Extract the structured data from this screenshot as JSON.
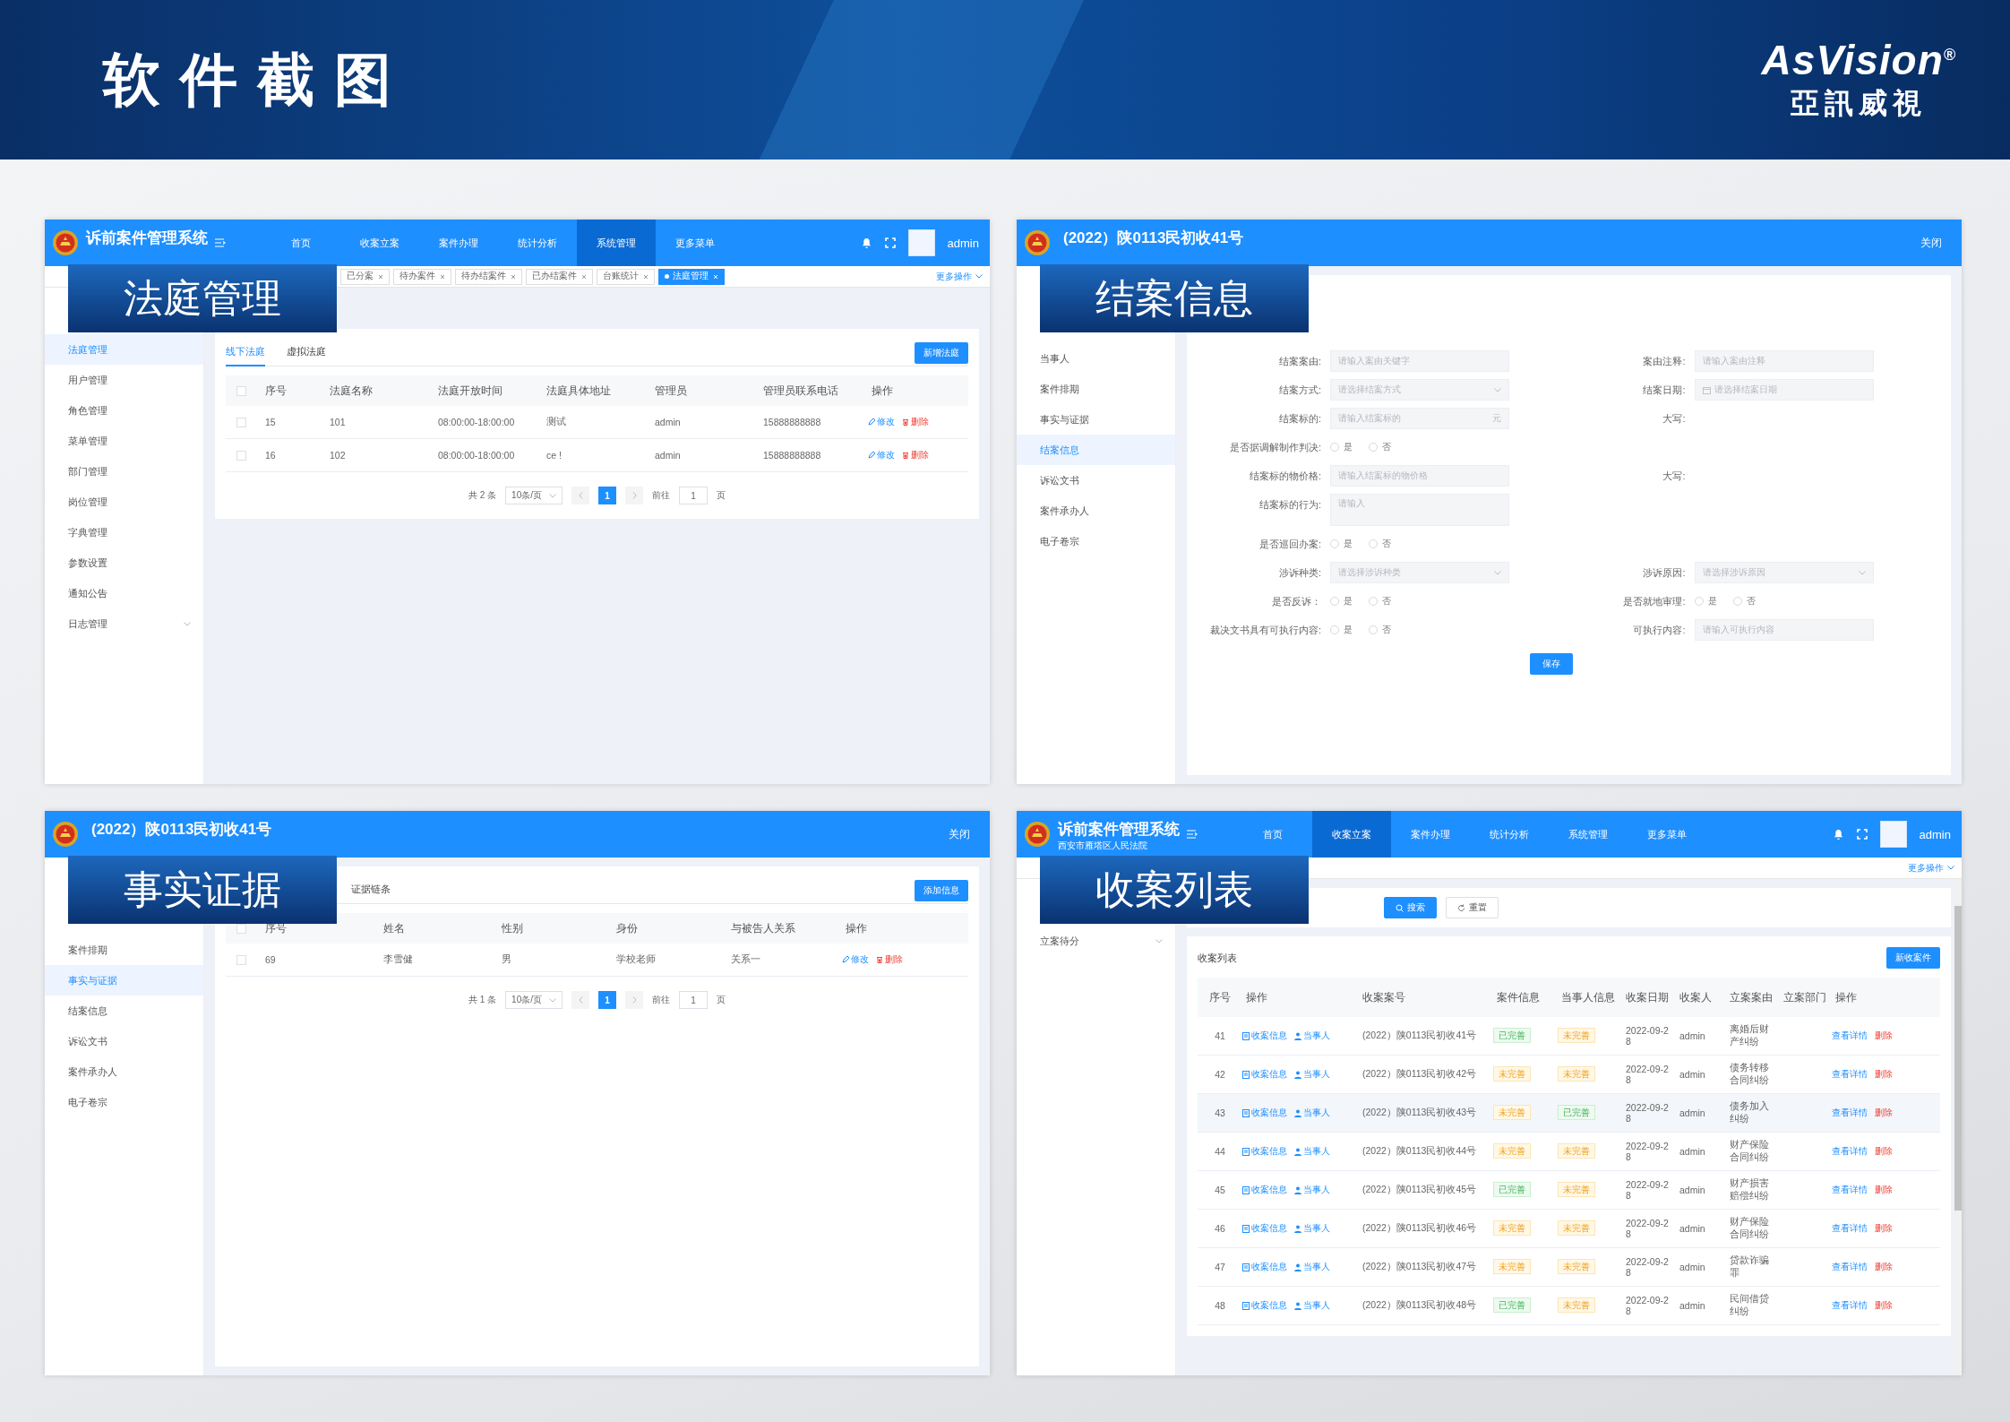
{
  "header": {
    "title": "软件截图",
    "brand": "AsVision",
    "brand_mark": "®",
    "brand_cn": "亞訊威視"
  },
  "panels": [
    {
      "kind": "court",
      "label": "法庭管理",
      "app": {
        "title": "诉前案件管理系统",
        "nav": [
          {
            "label": "首页",
            "selected": false
          },
          {
            "label": "收案立案",
            "selected": false
          },
          {
            "label": "案件办理",
            "selected": false
          },
          {
            "label": "统计分析",
            "selected": false
          },
          {
            "label": "系统管理",
            "selected": true
          },
          {
            "label": "更多菜单",
            "selected": false
          }
        ],
        "user": "admin"
      },
      "tags": [
        {
          "label": "已分案",
          "selected": false
        },
        {
          "label": "待办案件",
          "selected": false
        },
        {
          "label": "待办结案件",
          "selected": false
        },
        {
          "label": "已办结案件",
          "selected": false
        },
        {
          "label": "台账统计",
          "selected": false
        },
        {
          "label": "法庭管理",
          "selected": true
        }
      ],
      "more": "更多操作",
      "sidebar": [
        {
          "label": "法庭管理",
          "selected": true
        },
        {
          "label": "用户管理",
          "selected": false
        },
        {
          "label": "角色管理",
          "selected": false
        },
        {
          "label": "菜单管理",
          "selected": false
        },
        {
          "label": "部门管理",
          "selected": false
        },
        {
          "label": "岗位管理",
          "selected": false
        },
        {
          "label": "字典管理",
          "selected": false
        },
        {
          "label": "参数设置",
          "selected": false
        },
        {
          "label": "通知公告",
          "selected": false
        },
        {
          "label": "日志管理",
          "selected": false,
          "expandable": true
        }
      ],
      "tabs": [
        {
          "label": "线下法庭",
          "selected": true
        },
        {
          "label": "虚拟法庭",
          "selected": false
        }
      ],
      "add_button": "新增法庭",
      "table": {
        "select_all_checked": false,
        "columns": [
          "序号",
          "法庭名称",
          "法庭开放时间",
          "法庭具体地址",
          "管理员",
          "管理员联系电话",
          "操作"
        ],
        "rows": [
          {
            "checked": false,
            "cells": [
              "15",
              "101",
              "08:00:00-18:00:00",
              "测试",
              "admin",
              "15888888888"
            ],
            "actions": [
              "修改",
              "删除"
            ]
          },
          {
            "checked": false,
            "cells": [
              "16",
              "102",
              "08:00:00-18:00:00",
              "ce !",
              "admin",
              "15888888888"
            ],
            "actions": [
              "修改",
              "删除"
            ]
          }
        ]
      },
      "pagination": {
        "total": "共 2 条",
        "size": "10条/页",
        "pages": [
          {
            "label": "1",
            "selected": true
          }
        ],
        "goto": "前往",
        "goto_value": "1",
        "unit": "页"
      }
    },
    {
      "kind": "form",
      "label": "结案信息",
      "window": {
        "title": "(2022）陕0113民初收41号",
        "close": "关闭"
      },
      "sidebar": [
        {
          "label": "当事人",
          "selected": false
        },
        {
          "label": "案件排期",
          "selected": false
        },
        {
          "label": "事实与证据",
          "selected": false
        },
        {
          "label": "结案信息",
          "selected": true
        },
        {
          "label": "诉讼文书",
          "selected": false
        },
        {
          "label": "案件承办人",
          "selected": false
        },
        {
          "label": "电子卷宗",
          "selected": false
        }
      ],
      "form": {
        "rows": [
          {
            "left": {
              "label": "结案案由:",
              "kind": "input",
              "placeholder": "请输入案由关键字"
            },
            "right": {
              "label": "案由注释:",
              "kind": "input",
              "placeholder": "请输入案由注释"
            }
          },
          {
            "left": {
              "label": "结案方式:",
              "kind": "select",
              "placeholder": "请选择结案方式"
            },
            "right": {
              "label": "结案日期:",
              "kind": "date",
              "placeholder": "请选择结案日期"
            }
          },
          {
            "left": {
              "label": "结案标的:",
              "kind": "input",
              "placeholder": "请输入结案标的",
              "suffix": "元"
            },
            "right": {
              "label": "大写:",
              "kind": "text"
            }
          },
          {
            "left": {
              "label": "是否据调解制作判决:",
              "kind": "radio",
              "options": [
                {
                  "label": "是",
                  "selected": false
                },
                {
                  "label": "否",
                  "selected": false
                }
              ]
            }
          },
          {
            "left": {
              "label": "结案标的物价格:",
              "kind": "input",
              "placeholder": "请输入结案标的物价格"
            },
            "right": {
              "label": "大写:",
              "kind": "text"
            }
          },
          {
            "left": {
              "label": "结案标的行为:",
              "kind": "textarea",
              "placeholder": "请输入"
            }
          },
          {
            "left": {
              "label": "是否巡回办案:",
              "kind": "radio",
              "options": [
                {
                  "label": "是",
                  "selected": false
                },
                {
                  "label": "否",
                  "selected": false
                }
              ]
            }
          },
          {
            "left": {
              "label": "涉诉种类:",
              "kind": "select",
              "placeholder": "请选择涉诉种类"
            },
            "right": {
              "label": "涉诉原因:",
              "kind": "select",
              "placeholder": "请选择涉诉原因"
            }
          },
          {
            "left": {
              "label": "是否反诉：",
              "kind": "radio",
              "options": [
                {
                  "label": "是",
                  "selected": false
                },
                {
                  "label": "否",
                  "selected": false
                }
              ]
            },
            "right": {
              "label": "是否就地审理:",
              "kind": "radio",
              "options": [
                {
                  "label": "是",
                  "selected": false
                },
                {
                  "label": "否",
                  "selected": false
                }
              ]
            }
          },
          {
            "left": {
              "label": "裁决文书具有可执行内容:",
              "kind": "radio",
              "options": [
                {
                  "label": "是",
                  "selected": false
                },
                {
                  "label": "否",
                  "selected": false
                }
              ]
            },
            "right": {
              "label": "可执行内容:",
              "kind": "input",
              "placeholder": "请输入可执行内容"
            }
          }
        ],
        "save": "保存"
      }
    },
    {
      "kind": "evidence",
      "label": "事实证据",
      "window": {
        "title": "(2022）陕0113民初收41号",
        "close": "关闭"
      },
      "sidebar": [
        {
          "label": "案件排期",
          "selected": false
        },
        {
          "label": "事实与证据",
          "selected": true
        },
        {
          "label": "结案信息",
          "selected": false
        },
        {
          "label": "诉讼文书",
          "selected": false
        },
        {
          "label": "案件承办人",
          "selected": false
        },
        {
          "label": "电子卷宗",
          "selected": false
        }
      ],
      "tabs": [
        {
          "label": "证据链条",
          "selected": false
        }
      ],
      "add_button": "添加信息",
      "table": {
        "select_all_checked": false,
        "columns": [
          "序号",
          "姓名",
          "性别",
          "身份",
          "与被告人关系",
          "操作"
        ],
        "rows": [
          {
            "checked": false,
            "cells": [
              "69",
              "李雪健",
              "男",
              "学校老师",
              "关系一"
            ],
            "actions": [
              "修改",
              "删除"
            ]
          }
        ]
      },
      "pagination": {
        "total": "共 1 条",
        "size": "10条/页",
        "pages": [
          {
            "label": "1",
            "selected": true
          }
        ],
        "goto": "前往",
        "goto_value": "1",
        "unit": "页"
      }
    },
    {
      "kind": "list",
      "label": "收案列表",
      "app": {
        "title": "诉前案件管理系统",
        "subtitle": "西安市雁塔区人民法院",
        "nav": [
          {
            "label": "首页",
            "selected": false
          },
          {
            "label": "收案立案",
            "selected": true
          },
          {
            "label": "案件办理",
            "selected": false
          },
          {
            "label": "统计分析",
            "selected": false
          },
          {
            "label": "系统管理",
            "selected": false
          },
          {
            "label": "更多菜单",
            "selected": false
          }
        ],
        "user": "admin"
      },
      "more": "更多操作",
      "search": "搜索",
      "reset": "重置",
      "sidebar": [
        {
          "label": "立案待分",
          "selected": false,
          "expandable": true
        }
      ],
      "list_title": "收案列表",
      "add_button": "新收案件",
      "table": {
        "columns": [
          "序号",
          "操作",
          "收案案号",
          "案件信息",
          "当事人信息",
          "收案日期",
          "收案人",
          "立案案由",
          "立案部门",
          "操作"
        ],
        "rows": [
          {
            "selected": false,
            "no": "41",
            "links": [
              "收案信息",
              "当事人"
            ],
            "case": "(2022）陕0113民初收41号",
            "info": {
              "label": "已完善",
              "complete": true
            },
            "party": {
              "label": "未完善",
              "complete": false
            },
            "date": "2022-09-28",
            "user": "admin",
            "reason": "离婚后财产纠纷",
            "actions": [
              "查看详情",
              "删除"
            ]
          },
          {
            "selected": false,
            "no": "42",
            "links": [
              "收案信息",
              "当事人"
            ],
            "case": "(2022）陕0113民初收42号",
            "info": {
              "label": "未完善",
              "complete": false
            },
            "party": {
              "label": "未完善",
              "complete": false
            },
            "date": "2022-09-28",
            "user": "admin",
            "reason": "债务转移合同纠纷",
            "actions": [
              "查看详情",
              "删除"
            ]
          },
          {
            "selected": true,
            "no": "43",
            "links": [
              "收案信息",
              "当事人"
            ],
            "case": "(2022）陕0113民初收43号",
            "info": {
              "label": "未完善",
              "complete": false
            },
            "party": {
              "label": "已完善",
              "complete": true
            },
            "date": "2022-09-28",
            "user": "admin",
            "reason": "债务加入纠纷",
            "actions": [
              "查看详情",
              "删除"
            ]
          },
          {
            "selected": false,
            "no": "44",
            "links": [
              "收案信息",
              "当事人"
            ],
            "case": "(2022）陕0113民初收44号",
            "info": {
              "label": "未完善",
              "complete": false
            },
            "party": {
              "label": "未完善",
              "complete": false
            },
            "date": "2022-09-28",
            "user": "admin",
            "reason": "财产保险合同纠纷",
            "actions": [
              "查看详情",
              "删除"
            ]
          },
          {
            "selected": false,
            "no": "45",
            "links": [
              "收案信息",
              "当事人"
            ],
            "case": "(2022）陕0113民初收45号",
            "info": {
              "label": "已完善",
              "complete": true
            },
            "party": {
              "label": "未完善",
              "complete": false
            },
            "date": "2022-09-28",
            "user": "admin",
            "reason": "财产损害赔偿纠纷",
            "actions": [
              "查看详情",
              "删除"
            ]
          },
          {
            "selected": false,
            "no": "46",
            "links": [
              "收案信息",
              "当事人"
            ],
            "case": "(2022）陕0113民初收46号",
            "info": {
              "label": "未完善",
              "complete": false
            },
            "party": {
              "label": "未完善",
              "complete": false
            },
            "date": "2022-09-28",
            "user": "admin",
            "reason": "财产保险合同纠纷",
            "actions": [
              "查看详情",
              "删除"
            ]
          },
          {
            "selected": false,
            "no": "47",
            "links": [
              "收案信息",
              "当事人"
            ],
            "case": "(2022）陕0113民初收47号",
            "info": {
              "label": "未完善",
              "complete": false
            },
            "party": {
              "label": "未完善",
              "complete": false
            },
            "date": "2022-09-28",
            "user": "admin",
            "reason": "贷款诈骗罪",
            "actions": [
              "查看详情",
              "删除"
            ]
          },
          {
            "selected": false,
            "no": "48",
            "links": [
              "收案信息",
              "当事人"
            ],
            "case": "(2022）陕0113民初收48号",
            "info": {
              "label": "已完善",
              "complete": true
            },
            "party": {
              "label": "未完善",
              "complete": false
            },
            "date": "2022-09-28",
            "user": "admin",
            "reason": "民间借贷纠纷",
            "actions": [
              "查看详情",
              "删除"
            ]
          }
        ]
      }
    }
  ]
}
